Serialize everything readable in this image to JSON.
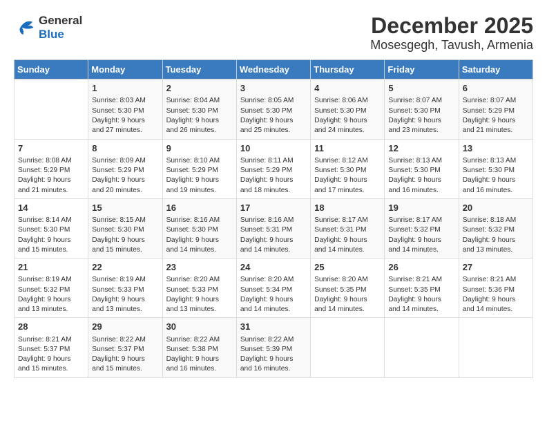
{
  "logo": {
    "line1": "General",
    "line2": "Blue"
  },
  "title": "December 2025",
  "subtitle": "Mosesgegh, Tavush, Armenia",
  "days_of_week": [
    "Sunday",
    "Monday",
    "Tuesday",
    "Wednesday",
    "Thursday",
    "Friday",
    "Saturday"
  ],
  "weeks": [
    [
      {
        "day": "",
        "info": ""
      },
      {
        "day": "1",
        "info": "Sunrise: 8:03 AM\nSunset: 5:30 PM\nDaylight: 9 hours\nand 27 minutes."
      },
      {
        "day": "2",
        "info": "Sunrise: 8:04 AM\nSunset: 5:30 PM\nDaylight: 9 hours\nand 26 minutes."
      },
      {
        "day": "3",
        "info": "Sunrise: 8:05 AM\nSunset: 5:30 PM\nDaylight: 9 hours\nand 25 minutes."
      },
      {
        "day": "4",
        "info": "Sunrise: 8:06 AM\nSunset: 5:30 PM\nDaylight: 9 hours\nand 24 minutes."
      },
      {
        "day": "5",
        "info": "Sunrise: 8:07 AM\nSunset: 5:30 PM\nDaylight: 9 hours\nand 23 minutes."
      },
      {
        "day": "6",
        "info": "Sunrise: 8:07 AM\nSunset: 5:29 PM\nDaylight: 9 hours\nand 21 minutes."
      }
    ],
    [
      {
        "day": "7",
        "info": "Sunrise: 8:08 AM\nSunset: 5:29 PM\nDaylight: 9 hours\nand 21 minutes."
      },
      {
        "day": "8",
        "info": "Sunrise: 8:09 AM\nSunset: 5:29 PM\nDaylight: 9 hours\nand 20 minutes."
      },
      {
        "day": "9",
        "info": "Sunrise: 8:10 AM\nSunset: 5:29 PM\nDaylight: 9 hours\nand 19 minutes."
      },
      {
        "day": "10",
        "info": "Sunrise: 8:11 AM\nSunset: 5:29 PM\nDaylight: 9 hours\nand 18 minutes."
      },
      {
        "day": "11",
        "info": "Sunrise: 8:12 AM\nSunset: 5:30 PM\nDaylight: 9 hours\nand 17 minutes."
      },
      {
        "day": "12",
        "info": "Sunrise: 8:13 AM\nSunset: 5:30 PM\nDaylight: 9 hours\nand 16 minutes."
      },
      {
        "day": "13",
        "info": "Sunrise: 8:13 AM\nSunset: 5:30 PM\nDaylight: 9 hours\nand 16 minutes."
      }
    ],
    [
      {
        "day": "14",
        "info": "Sunrise: 8:14 AM\nSunset: 5:30 PM\nDaylight: 9 hours\nand 15 minutes."
      },
      {
        "day": "15",
        "info": "Sunrise: 8:15 AM\nSunset: 5:30 PM\nDaylight: 9 hours\nand 15 minutes."
      },
      {
        "day": "16",
        "info": "Sunrise: 8:16 AM\nSunset: 5:30 PM\nDaylight: 9 hours\nand 14 minutes."
      },
      {
        "day": "17",
        "info": "Sunrise: 8:16 AM\nSunset: 5:31 PM\nDaylight: 9 hours\nand 14 minutes."
      },
      {
        "day": "18",
        "info": "Sunrise: 8:17 AM\nSunset: 5:31 PM\nDaylight: 9 hours\nand 14 minutes."
      },
      {
        "day": "19",
        "info": "Sunrise: 8:17 AM\nSunset: 5:32 PM\nDaylight: 9 hours\nand 14 minutes."
      },
      {
        "day": "20",
        "info": "Sunrise: 8:18 AM\nSunset: 5:32 PM\nDaylight: 9 hours\nand 13 minutes."
      }
    ],
    [
      {
        "day": "21",
        "info": "Sunrise: 8:19 AM\nSunset: 5:32 PM\nDaylight: 9 hours\nand 13 minutes."
      },
      {
        "day": "22",
        "info": "Sunrise: 8:19 AM\nSunset: 5:33 PM\nDaylight: 9 hours\nand 13 minutes."
      },
      {
        "day": "23",
        "info": "Sunrise: 8:20 AM\nSunset: 5:33 PM\nDaylight: 9 hours\nand 13 minutes."
      },
      {
        "day": "24",
        "info": "Sunrise: 8:20 AM\nSunset: 5:34 PM\nDaylight: 9 hours\nand 14 minutes."
      },
      {
        "day": "25",
        "info": "Sunrise: 8:20 AM\nSunset: 5:35 PM\nDaylight: 9 hours\nand 14 minutes."
      },
      {
        "day": "26",
        "info": "Sunrise: 8:21 AM\nSunset: 5:35 PM\nDaylight: 9 hours\nand 14 minutes."
      },
      {
        "day": "27",
        "info": "Sunrise: 8:21 AM\nSunset: 5:36 PM\nDaylight: 9 hours\nand 14 minutes."
      }
    ],
    [
      {
        "day": "28",
        "info": "Sunrise: 8:21 AM\nSunset: 5:37 PM\nDaylight: 9 hours\nand 15 minutes."
      },
      {
        "day": "29",
        "info": "Sunrise: 8:22 AM\nSunset: 5:37 PM\nDaylight: 9 hours\nand 15 minutes."
      },
      {
        "day": "30",
        "info": "Sunrise: 8:22 AM\nSunset: 5:38 PM\nDaylight: 9 hours\nand 16 minutes."
      },
      {
        "day": "31",
        "info": "Sunrise: 8:22 AM\nSunset: 5:39 PM\nDaylight: 9 hours\nand 16 minutes."
      },
      {
        "day": "",
        "info": ""
      },
      {
        "day": "",
        "info": ""
      },
      {
        "day": "",
        "info": ""
      }
    ]
  ]
}
